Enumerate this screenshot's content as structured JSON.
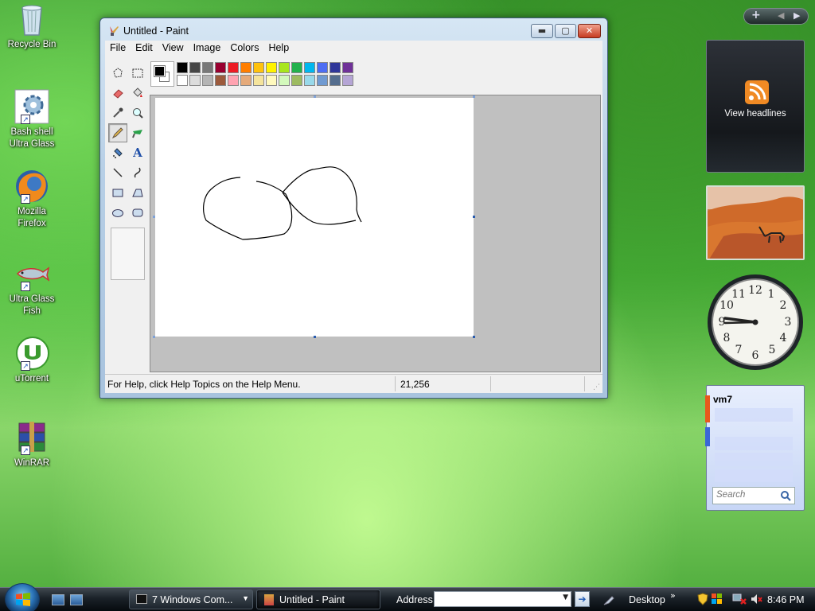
{
  "desktop": {
    "icons": [
      {
        "label": "Recycle Bin"
      },
      {
        "label_line1": "Bash shell",
        "label_line2": "Ultra Glass"
      },
      {
        "label_line1": "Mozilla",
        "label_line2": "Firefox"
      },
      {
        "label_line1": "Ultra Glass",
        "label_line2": "Fish"
      },
      {
        "label": "uTorrent"
      },
      {
        "label": "WinRAR"
      }
    ]
  },
  "paint": {
    "title": "Untitled - Paint",
    "menu": [
      "File",
      "Edit",
      "View",
      "Image",
      "Colors",
      "Help"
    ],
    "status_text": "For Help, click Help Topics on the Help Menu.",
    "coordinates": "21,256",
    "text_tool_glyph": "A",
    "palette_top": [
      "#000000",
      "#464646",
      "#787878",
      "#990030",
      "#ed1c24",
      "#ff7e00",
      "#ffc20e",
      "#fff200",
      "#a8e61d",
      "#22b14c",
      "#00b7ef",
      "#4d6df3",
      "#2f3699",
      "#6f3198"
    ],
    "palette_bottom": [
      "#ffffff",
      "#dcdcdc",
      "#b4b4b4",
      "#9c5a3c",
      "#ffa3b1",
      "#e5aa7a",
      "#f5e49c",
      "#fff9bd",
      "#d3f9bc",
      "#9dbb61",
      "#99d9ea",
      "#709ad1",
      "#546d8e",
      "#b5a5d5"
    ],
    "foreground_color": "#000000",
    "background_color": "#ffffff"
  },
  "sidebar": {
    "feed_label": "View headlines",
    "contacts_title": "vm7",
    "search_placeholder": "Search"
  },
  "taskbar": {
    "task1_label": "7 Windows Com...",
    "task2_label": "Untitled - Paint",
    "address_label": "Address",
    "desktop_label": "Desktop",
    "clock": "8:46 PM"
  }
}
